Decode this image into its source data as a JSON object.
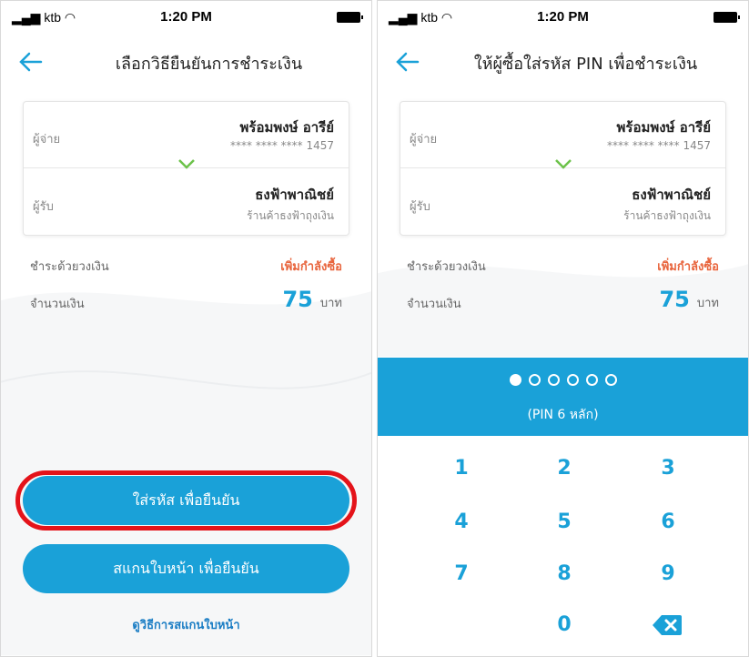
{
  "status": {
    "carrier": "ktb",
    "time": "1:20 PM"
  },
  "left": {
    "title": "เลือกวิธียืนยันการชำระเงิน",
    "payer_label": "ผู้จ่าย",
    "payer_name": "พร้อมพงษ์ อารีย์",
    "payer_account": "**** **** **** 1457",
    "payee_label": "ผู้รับ",
    "payee_name": "ธงฟ้าพาณิชย์",
    "payee_sub": "ร้านค้าธงฟ้าถุงเงิน",
    "pay_with_label": "ชำระด้วยวงเงิน",
    "pay_with_value": "เพิ่มกำลังซื้อ",
    "amount_label": "จำนวนเงิน",
    "amount_value": "75",
    "amount_unit": "บาท",
    "btn_pin": "ใส่รหัส เพื่อยืนยัน",
    "btn_face": "สแกนใบหน้า เพื่อยืนยัน",
    "link_face_help": "ดูวิธีการสแกนใบหน้า"
  },
  "right": {
    "title": "ให้ผู้ซื้อใส่รหัส PIN เพื่อชำระเงิน",
    "payer_label": "ผู้จ่าย",
    "payer_name": "พร้อมพงษ์ อารีย์",
    "payer_account": "**** **** **** 1457",
    "payee_label": "ผู้รับ",
    "payee_name": "ธงฟ้าพาณิชย์",
    "payee_sub": "ร้านค้าธงฟ้าถุงเงิน",
    "pay_with_label": "ชำระด้วยวงเงิน",
    "pay_with_value": "เพิ่มกำลังซื้อ",
    "amount_label": "จำนวนเงิน",
    "amount_value": "75",
    "amount_unit": "บาท",
    "pin_filled": 1,
    "pin_hint": "(PIN 6 หลัก)",
    "keys": [
      "1",
      "2",
      "3",
      "4",
      "5",
      "6",
      "7",
      "8",
      "9",
      "0"
    ]
  },
  "colors": {
    "accent": "#1aa1d8",
    "orange": "#e8643c",
    "highlight": "#e4131a"
  }
}
